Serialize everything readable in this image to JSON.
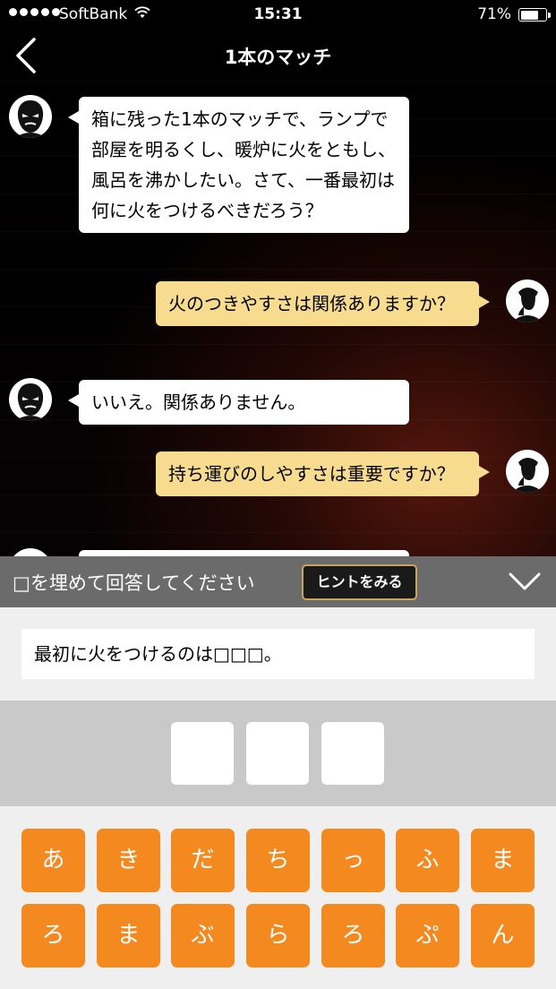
{
  "status_bar": {
    "carrier": "SoftBank",
    "time": "15:31",
    "battery": "71%",
    "battery_level": 0.71
  },
  "header": {
    "title": "1本のマッチ"
  },
  "chat": {
    "messages": [
      {
        "from": "host",
        "text": "箱に残った1本のマッチで、ランプで部屋を明るくし、暖炉に火をともし、風呂を沸かしたい。さて、一番最初は何に火をつけるべきだろう？"
      },
      {
        "from": "player",
        "text": "火のつきやすさは関係ありますか？"
      },
      {
        "from": "host",
        "text": "いいえ。関係ありません。"
      },
      {
        "from": "player",
        "text": "持ち運びのしやすさは重要ですか？"
      }
    ]
  },
  "answer": {
    "instruction": "□を埋めて回答してください",
    "hint_label": "ヒントをみる",
    "question": "最初に火をつけるのは□□□。",
    "slots": [
      "",
      "",
      ""
    ]
  },
  "keyboard": {
    "keys": [
      "あ",
      "き",
      "だ",
      "ち",
      "っ",
      "ふ",
      "ま",
      "ろ",
      "ま",
      "ぶ",
      "ら",
      "ろ",
      "ぷ",
      "ん"
    ]
  },
  "colors": {
    "key": "#f4891f",
    "player_bubble": "#f7db8f",
    "hint_border": "#c9a55b"
  }
}
